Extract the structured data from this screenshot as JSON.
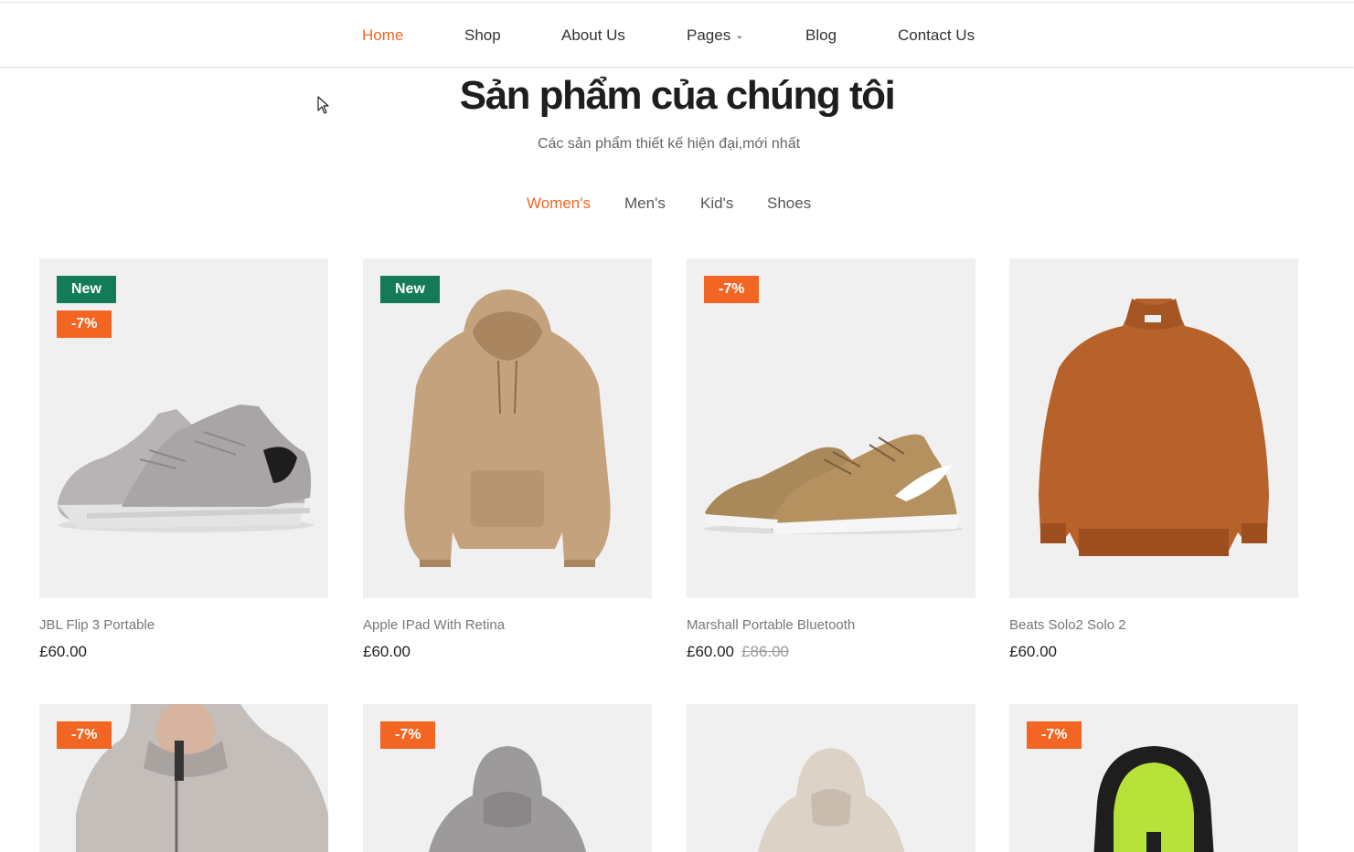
{
  "nav": {
    "items": [
      {
        "label": "Home",
        "active": true
      },
      {
        "label": "Shop"
      },
      {
        "label": "About Us"
      },
      {
        "label": "Pages"
      },
      {
        "label": "Blog"
      },
      {
        "label": "Contact Us"
      }
    ]
  },
  "section": {
    "title": "Sản phẩm của chúng tôi",
    "subtitle": "Các sản phẩm thiết kế hiện đại,mới nhất"
  },
  "tabs": [
    "Women's",
    "Men's",
    "Kid's",
    "Shoes"
  ],
  "products": [
    {
      "name": "JBL Flip 3 Portable",
      "price": "£60.00",
      "old_price": "",
      "badges": [
        "New",
        "-7%"
      ]
    },
    {
      "name": "Apple IPad With Retina",
      "price": "£60.00",
      "old_price": "",
      "badges": [
        "New"
      ]
    },
    {
      "name": "Marshall Portable Bluetooth",
      "price": "£60.00",
      "old_price": "£86.00",
      "badges": [
        "-7%"
      ]
    },
    {
      "name": "Beats Solo2 Solo 2",
      "price": "£60.00",
      "old_price": "",
      "badges": []
    }
  ],
  "products_row2": [
    {
      "badges": [
        "-7%"
      ]
    },
    {
      "badges": [
        "-7%"
      ]
    },
    {
      "badges": []
    },
    {
      "badges": [
        "-7%"
      ]
    }
  ],
  "colors": {
    "accent": "#f26522",
    "new_badge": "#137c57",
    "card_bg": "#f0f0f0"
  }
}
